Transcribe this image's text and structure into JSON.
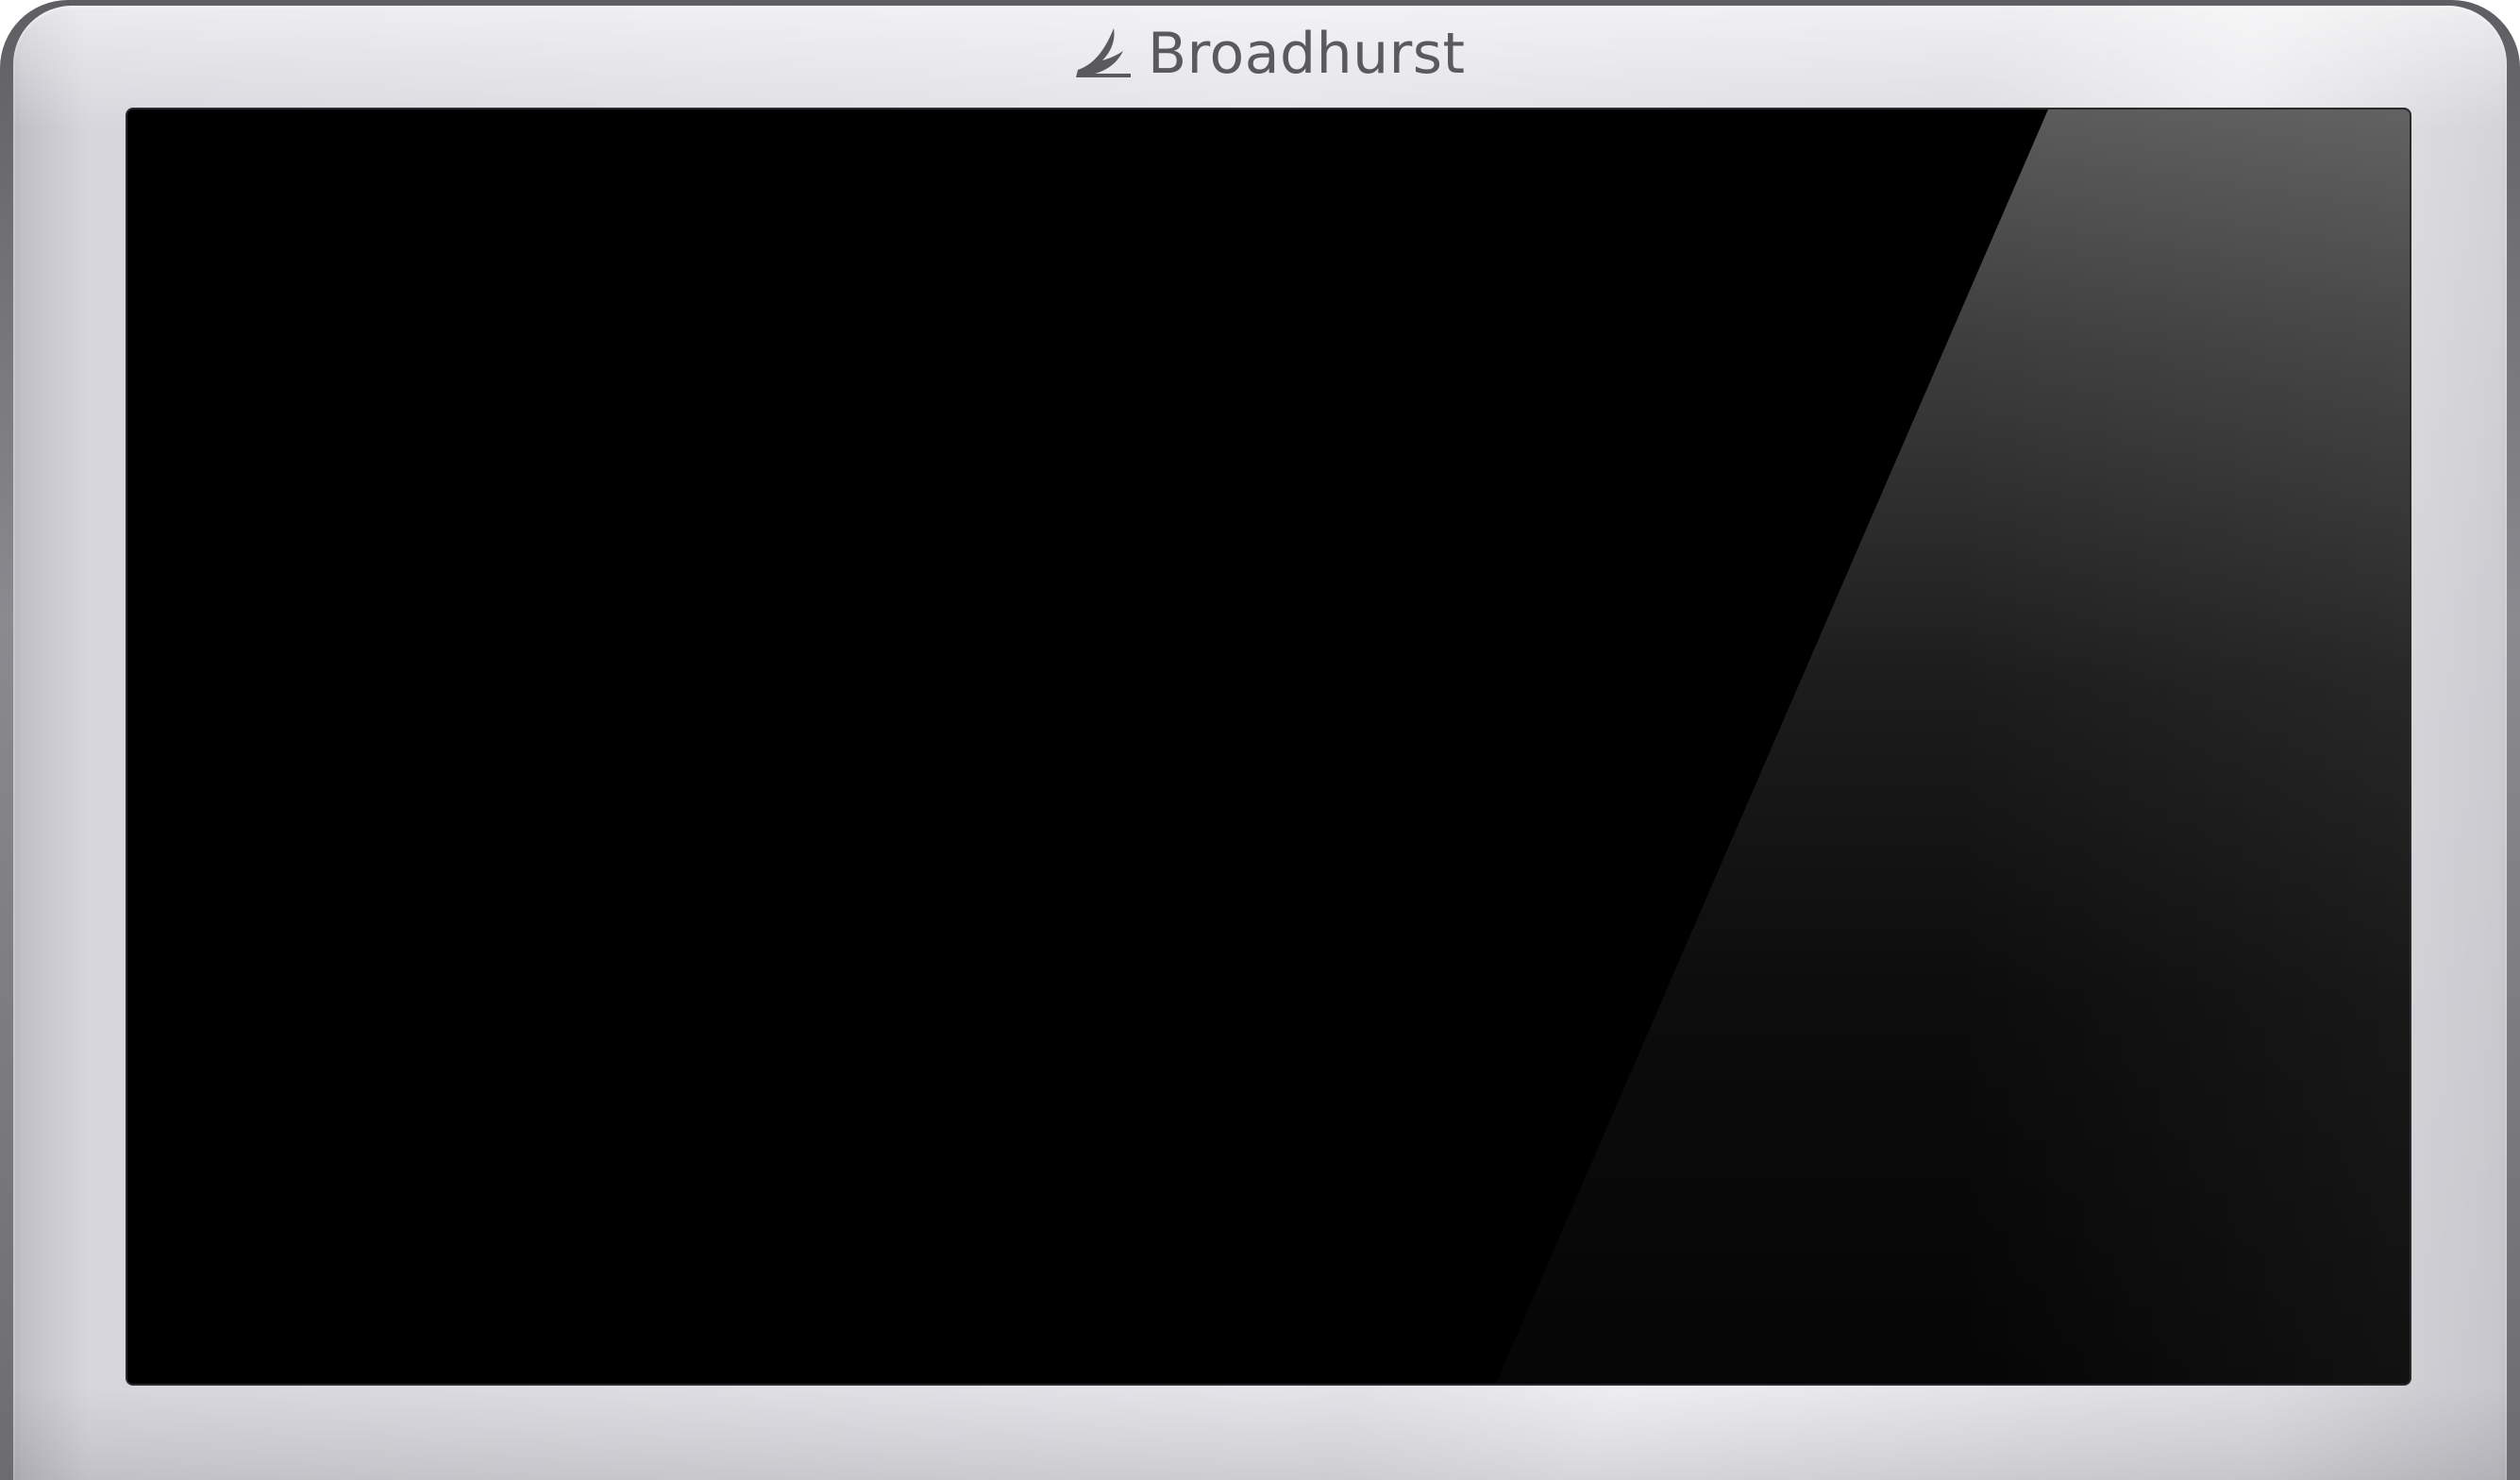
{
  "brand": {
    "name": "Broadhurst",
    "icon": "broadhurst-logo-icon"
  },
  "screen": {
    "state": "off"
  },
  "colors": {
    "bezel": "#e0e0e5",
    "rim": "#6a6a6e",
    "screen": "#000000",
    "brand_text": "#5a5a5e"
  }
}
